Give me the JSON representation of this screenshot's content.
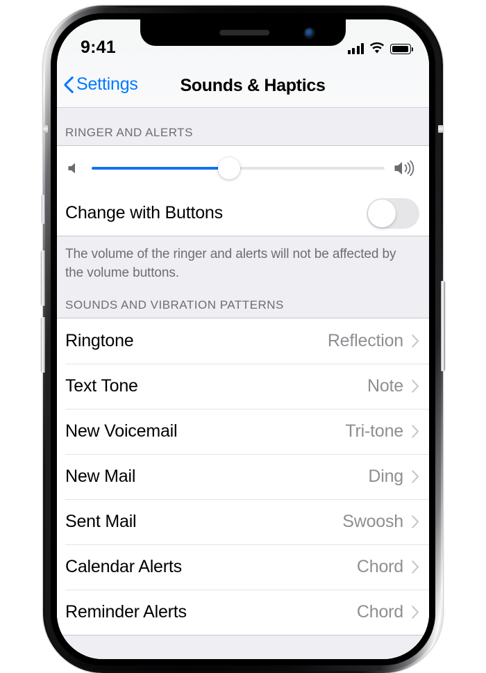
{
  "device": {
    "frame": "iphone-x",
    "buttons": [
      "ring-silent-switch",
      "volume-up",
      "volume-down",
      "side-button"
    ]
  },
  "status_bar": {
    "time": "9:41",
    "cellular_icon": "cellular-signal-icon",
    "cellular_bars": 4,
    "wifi_icon": "wifi-icon",
    "battery_icon": "battery-icon",
    "battery_level": 100
  },
  "nav": {
    "back_label": "Settings",
    "back_icon": "chevron-left-icon",
    "title": "Sounds & Haptics",
    "accent_color": "#007aff"
  },
  "sections": {
    "ringer": {
      "header": "RINGER AND ALERTS",
      "slider": {
        "min_icon": "speaker-low-icon",
        "max_icon": "speaker-high-icon",
        "value": 47,
        "min": 0,
        "max": 100,
        "fill_color": "#1273ef"
      },
      "toggle_row": {
        "label": "Change with Buttons",
        "state": "off"
      },
      "footer": "The volume of the ringer and alerts will not be affected by the volume buttons."
    },
    "sounds": {
      "header": "SOUNDS AND VIBRATION PATTERNS",
      "rows": [
        {
          "label": "Ringtone",
          "value": "Reflection"
        },
        {
          "label": "Text Tone",
          "value": "Note"
        },
        {
          "label": "New Voicemail",
          "value": "Tri-tone"
        },
        {
          "label": "New Mail",
          "value": "Ding"
        },
        {
          "label": "Sent Mail",
          "value": "Swoosh"
        },
        {
          "label": "Calendar Alerts",
          "value": "Chord"
        },
        {
          "label": "Reminder Alerts",
          "value": "Chord"
        }
      ]
    }
  }
}
